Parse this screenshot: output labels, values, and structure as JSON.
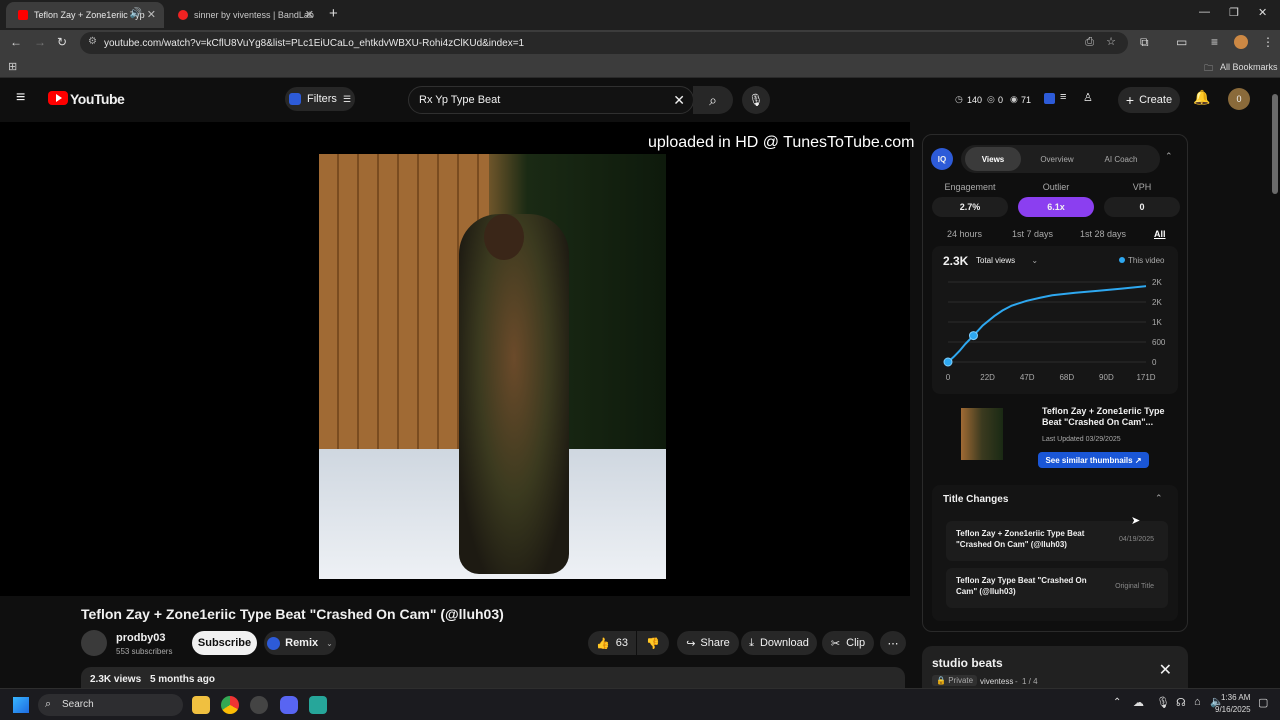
{
  "browser": {
    "tabs": [
      {
        "title": "Teflon Zay + Zone1eriic Typ",
        "active": true
      },
      {
        "title": "sinner by viventess | BandLab",
        "active": false
      }
    ],
    "new_tab": "+",
    "url": "youtube.com/watch?v=kCflU8VuYg8&list=PLc1EiUCaLo_ehtkdvWBXU-Rohi4zClKUd&index=1",
    "all_bookmarks": "All Bookmarks"
  },
  "youtube": {
    "logo_text": "YouTube",
    "filters_label": "Filters",
    "search_value": "Rx Yp Type Beat",
    "header_stats": {
      "s1": "140",
      "s2": "0",
      "s3": "71"
    },
    "create_label": "Create",
    "avatar_text": "0"
  },
  "video": {
    "watermark": "uploaded in HD @ TunesToTube.com",
    "title": "Teflon Zay + Zone1eriic Type Beat \"Crashed On Cam\" (@lluh03)",
    "channel": "prodby03",
    "subscribers": "553 subscribers",
    "subscribe_label": "Subscribe",
    "remix_label": "Remix",
    "likes": "63",
    "share_label": "Share",
    "download_label": "Download",
    "clip_label": "Clip",
    "views": "2.3K views",
    "age": "5 months ago"
  },
  "panel": {
    "badge": "IQ",
    "tabs": [
      "Views",
      "Overview",
      "AI Coach"
    ],
    "stats": [
      {
        "label": "Engagement",
        "value": "2.7%"
      },
      {
        "label": "Outlier",
        "value": "6.1x"
      },
      {
        "label": "VPH",
        "value": "0"
      }
    ],
    "ranges": [
      "24 hours",
      "1st 7 days",
      "1st 28 days",
      "All"
    ],
    "total": "2.3K",
    "total_label": "Total views",
    "legend": "This video",
    "thumb_title": "Teflon Zay + Zone1eriic Type Beat \"Crashed On Cam\"...",
    "last_updated": "Last Updated 03/29/2025",
    "similar_label": "See similar thumbnails ↗",
    "title_changes_header": "Title Changes",
    "title_changes": [
      {
        "title": "Teflon Zay + Zone1eriic Type Beat \"Crashed On Cam\" (@lluh03)",
        "date": "04/19/2025"
      },
      {
        "title": "Teflon Zay Type Beat \"Crashed On Cam\" (@lluh03)",
        "date": "Original Title"
      }
    ]
  },
  "chart_data": {
    "type": "line",
    "title": "",
    "xlabel": "",
    "ylabel": "",
    "x_ticks": [
      "0",
      "22D",
      "47D",
      "68D",
      "90D",
      "171D"
    ],
    "y_ticks": [
      "0",
      "600",
      "1K",
      "2K",
      "2K"
    ],
    "series": [
      {
        "name": "This video",
        "x": [
          0,
          5,
          10,
          15,
          22,
          30,
          40,
          47,
          55,
          68,
          80,
          90,
          110,
          130,
          150,
          171
        ],
        "y": [
          0,
          150,
          320,
          520,
          760,
          1050,
          1320,
          1480,
          1620,
          1760,
          1850,
          1920,
          1990,
          2050,
          2110,
          2180
        ]
      }
    ],
    "xlim": [
      0,
      171
    ],
    "ylim": [
      0,
      2300
    ]
  },
  "playlist": {
    "title": "studio beats",
    "privacy": "Private",
    "owner": "viventess",
    "position": "1 / 4"
  },
  "taskbar": {
    "search_placeholder": "Search",
    "time": "1:36 AM",
    "date": "9/16/2025"
  }
}
